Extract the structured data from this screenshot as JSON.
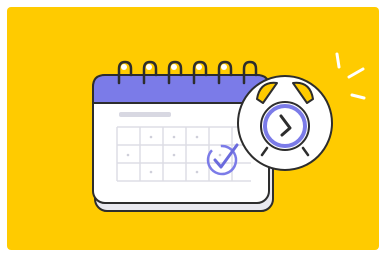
{
  "illustration": {
    "subject": "calendar-with-alarm-clock",
    "icons": [
      "calendar-icon",
      "alarm-clock-icon",
      "checkmark-icon"
    ]
  },
  "colors": {
    "background": "#FFCB00",
    "calendar_header": "#7B7BE8",
    "calendar_body": "#FFFFFF",
    "outline": "#2D2D2D",
    "accent_purple": "#6B6BDD",
    "bell_yellow": "#FFCB00",
    "shadow_grey": "#E7E7E7"
  }
}
